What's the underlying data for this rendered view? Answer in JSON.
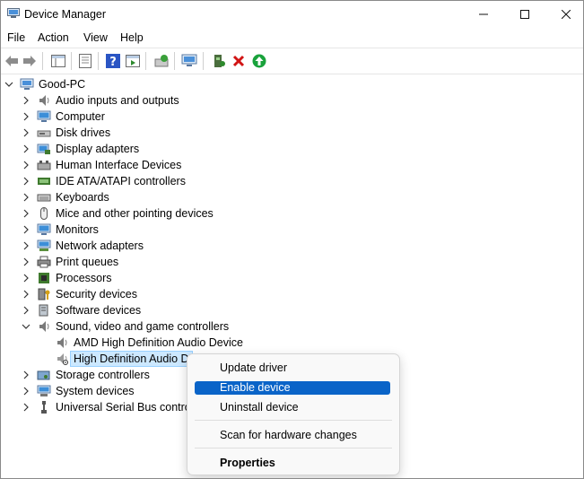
{
  "window": {
    "title": "Device Manager"
  },
  "menu": [
    "File",
    "Action",
    "View",
    "Help"
  ],
  "toolbar": {
    "icons": [
      "back-arrow-icon",
      "forward-arrow-icon",
      "show-hide-tree-icon",
      "properties-icon",
      "help-icon",
      "action-pane-icon",
      "update-driver-icon",
      "scan-hardware-icon",
      "enable-device-icon",
      "uninstall-icon",
      "update-icon"
    ]
  },
  "tree": {
    "root": "Good-PC",
    "categories": [
      {
        "label": "Audio inputs and outputs",
        "icon": "speaker-icon"
      },
      {
        "label": "Computer",
        "icon": "monitor-icon"
      },
      {
        "label": "Disk drives",
        "icon": "disk-icon"
      },
      {
        "label": "Display adapters",
        "icon": "display-adapter-icon"
      },
      {
        "label": "Human Interface Devices",
        "icon": "hid-icon"
      },
      {
        "label": "IDE ATA/ATAPI controllers",
        "icon": "ide-icon"
      },
      {
        "label": "Keyboards",
        "icon": "keyboard-icon"
      },
      {
        "label": "Mice and other pointing devices",
        "icon": "mouse-icon"
      },
      {
        "label": "Monitors",
        "icon": "monitor-icon"
      },
      {
        "label": "Network adapters",
        "icon": "network-icon"
      },
      {
        "label": "Print queues",
        "icon": "printer-icon"
      },
      {
        "label": "Processors",
        "icon": "processor-icon"
      },
      {
        "label": "Security devices",
        "icon": "security-icon"
      },
      {
        "label": "Software devices",
        "icon": "software-icon"
      },
      {
        "label": "Sound, video and game controllers",
        "icon": "speaker-icon",
        "expanded": true,
        "children": [
          {
            "label": "AMD High Definition Audio Device",
            "icon": "speaker-icon"
          },
          {
            "label": "High Definition Audio D",
            "icon": "speaker-disabled-icon",
            "selected": true
          }
        ]
      },
      {
        "label": "Storage controllers",
        "icon": "storage-icon"
      },
      {
        "label": "System devices",
        "icon": "system-icon"
      },
      {
        "label": "Universal Serial Bus controll",
        "icon": "usb-icon"
      }
    ]
  },
  "context_menu": {
    "items": [
      {
        "label": "Update driver"
      },
      {
        "label": "Enable device",
        "highlighted": true
      },
      {
        "label": "Uninstall device"
      },
      {
        "label": "Scan for hardware changes"
      },
      {
        "label": "Properties",
        "bold": true
      }
    ]
  }
}
